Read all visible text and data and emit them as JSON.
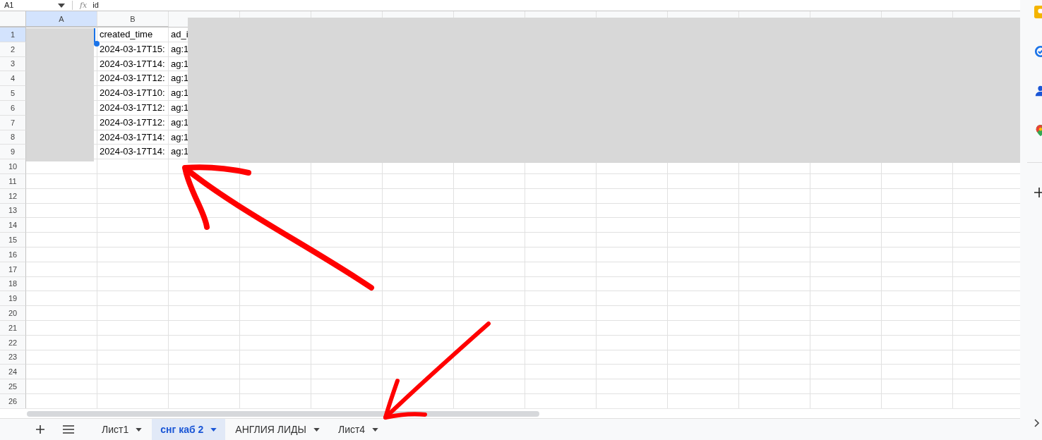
{
  "formula_bar": {
    "cell_reference": "A1",
    "function_label": "fx",
    "content": "id"
  },
  "columns": [
    {
      "letter": "A",
      "selected": true
    },
    {
      "letter": "B",
      "selected": false
    }
  ],
  "rows": [
    {
      "number": "1",
      "selected": true,
      "cells": [
        "created_time",
        "ad_i"
      ]
    },
    {
      "number": "2",
      "selected": false,
      "cells": [
        "2024-03-17T15:",
        "ag:1"
      ]
    },
    {
      "number": "3",
      "selected": false,
      "cells": [
        "2024-03-17T14:",
        "ag:1"
      ]
    },
    {
      "number": "4",
      "selected": false,
      "cells": [
        "2024-03-17T12:",
        "ag:1"
      ]
    },
    {
      "number": "5",
      "selected": false,
      "cells": [
        "2024-03-17T10:",
        "ag:1"
      ]
    },
    {
      "number": "6",
      "selected": false,
      "cells": [
        "2024-03-17T12:",
        "ag:1"
      ]
    },
    {
      "number": "7",
      "selected": false,
      "cells": [
        "2024-03-17T12:",
        "ag:1"
      ]
    },
    {
      "number": "8",
      "selected": false,
      "cells": [
        "2024-03-17T14:",
        "ag:1"
      ]
    },
    {
      "number": "9",
      "selected": false,
      "cells": [
        "2024-03-17T14:",
        "ag:1"
      ]
    },
    {
      "number": "10",
      "selected": false
    },
    {
      "number": "11",
      "selected": false
    },
    {
      "number": "12",
      "selected": false
    },
    {
      "number": "13",
      "selected": false
    },
    {
      "number": "14",
      "selected": false
    },
    {
      "number": "15",
      "selected": false
    },
    {
      "number": "16",
      "selected": false
    },
    {
      "number": "17",
      "selected": false
    },
    {
      "number": "18",
      "selected": false
    },
    {
      "number": "19",
      "selected": false
    },
    {
      "number": "20",
      "selected": false
    },
    {
      "number": "21",
      "selected": false
    },
    {
      "number": "22",
      "selected": false
    },
    {
      "number": "23",
      "selected": false
    },
    {
      "number": "24",
      "selected": false
    },
    {
      "number": "25",
      "selected": false
    },
    {
      "number": "26",
      "selected": false
    }
  ],
  "sheet_tabs": [
    {
      "label": "Лист1",
      "selected": false
    },
    {
      "label": "снг каб 2",
      "selected": true
    },
    {
      "label": "АНГЛИЯ ЛИДЫ",
      "selected": false
    },
    {
      "label": "Лист4",
      "selected": false
    }
  ]
}
